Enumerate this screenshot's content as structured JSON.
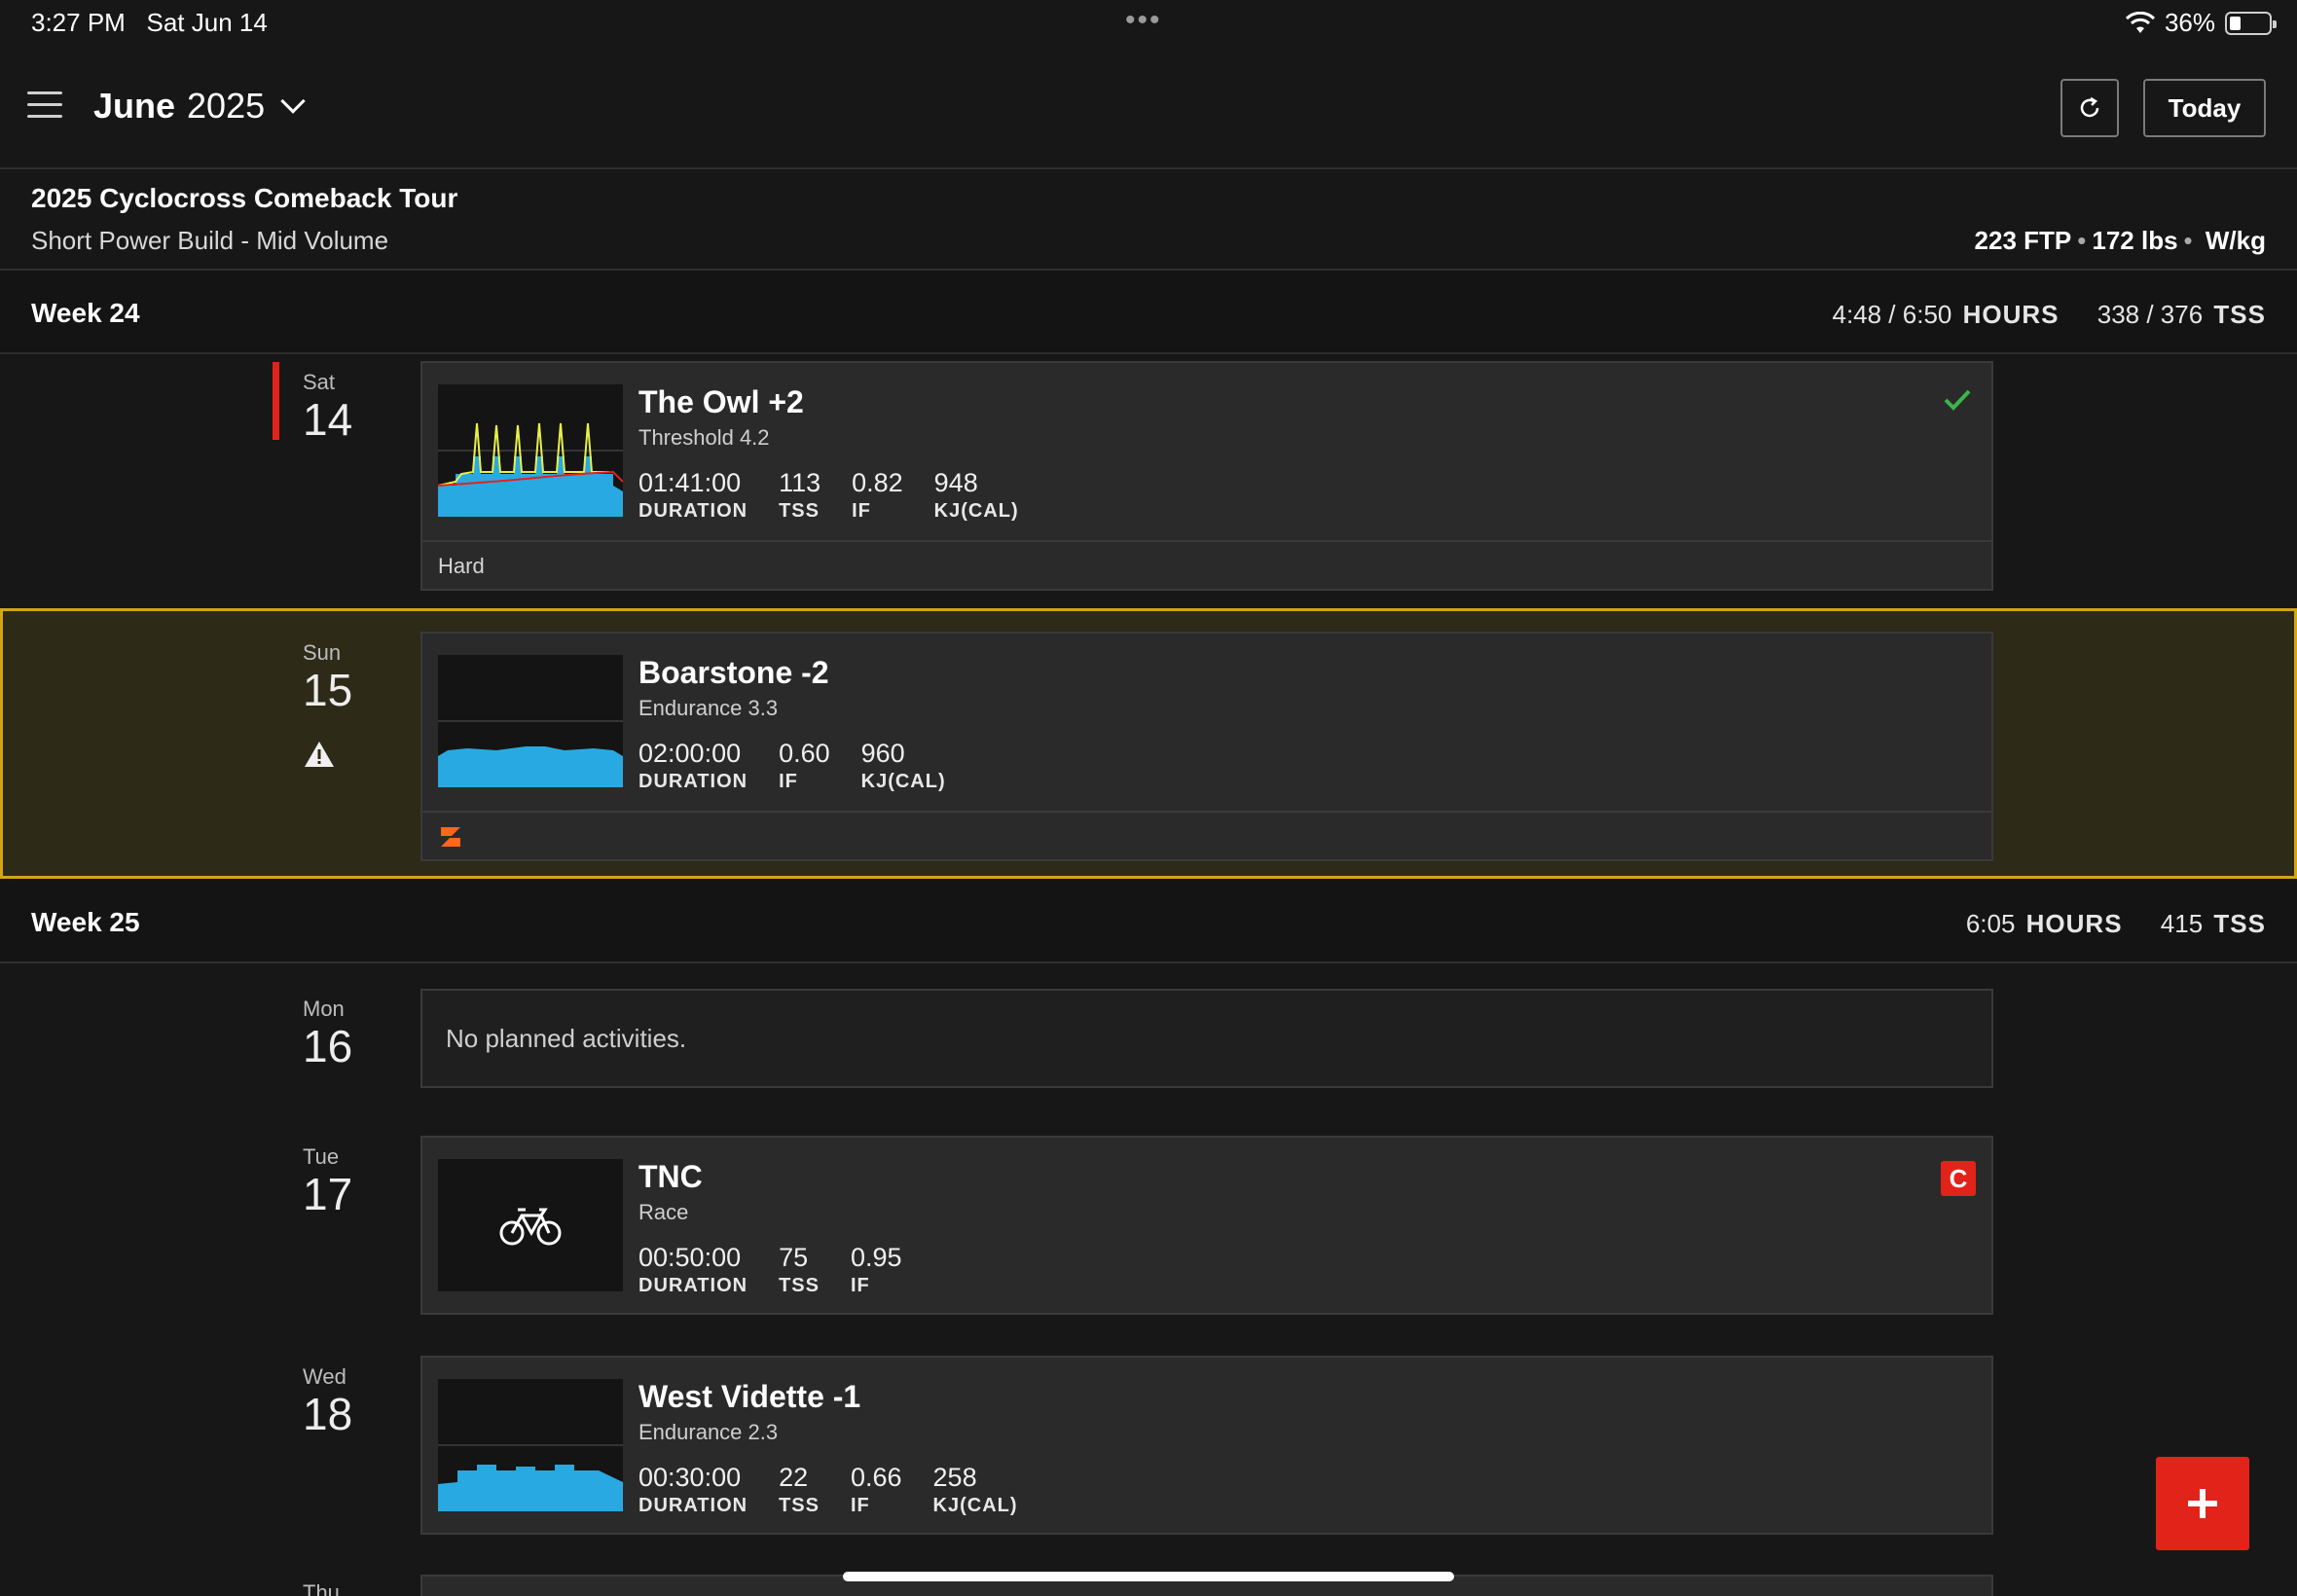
{
  "status": {
    "time": "3:27 PM",
    "date": "Sat Jun 14",
    "battery": "36%"
  },
  "header": {
    "month_bold": "June",
    "year": "2025",
    "today_label": "Today"
  },
  "plan": {
    "title": "2025 Cyclocross Comeback Tour",
    "subtitle": "Short Power Build - Mid Volume",
    "ftp": "223 FTP",
    "weight": "172 lbs",
    "unit": "W/kg"
  },
  "week24": {
    "title": "Week 24",
    "hours_val": "4:48 / 6:50",
    "hours_lbl": "HOURS",
    "tss_val": "338 / 376",
    "tss_lbl": "TSS"
  },
  "week25": {
    "title": "Week 25",
    "hours_val": "6:05",
    "hours_lbl": "HOURS",
    "tss_val": "415",
    "tss_lbl": "TSS"
  },
  "days": {
    "sat": {
      "name": "Sat",
      "num": "14"
    },
    "sun": {
      "name": "Sun",
      "num": "15"
    },
    "mon": {
      "name": "Mon",
      "num": "16"
    },
    "tue": {
      "name": "Tue",
      "num": "17"
    },
    "wed": {
      "name": "Wed",
      "num": "18"
    },
    "thu": {
      "name": "Thu"
    }
  },
  "workouts": {
    "owl": {
      "title": "The Owl +2",
      "subtitle": "Threshold 4.2",
      "duration": "01:41:00",
      "tss": "113",
      "if": "0.82",
      "kj": "948",
      "footer": "Hard"
    },
    "boarstone": {
      "title": "Boarstone -2",
      "subtitle": "Endurance 3.3",
      "duration": "02:00:00",
      "if": "0.60",
      "kj": "960"
    },
    "tnc": {
      "title": "TNC",
      "subtitle": "Race",
      "duration": "00:50:00",
      "tss": "75",
      "if": "0.95",
      "badge": "C"
    },
    "vidette": {
      "title": "West Vidette -1",
      "subtitle": "Endurance 2.3",
      "duration": "00:30:00",
      "tss": "22",
      "if": "0.66",
      "kj": "258"
    }
  },
  "labels": {
    "duration": "DURATION",
    "tss": "TSS",
    "if": "IF",
    "kj": "KJ(CAL)"
  },
  "empty_text": "No planned activities.",
  "colors": {
    "accent_red": "#e2231a",
    "power_blue": "#29a9e1",
    "highlight_gold": "#d4a514",
    "check_green": "#3db44a",
    "zwift_orange": "#fc6719"
  },
  "icons": {
    "menu": "menu-icon",
    "refresh": "refresh-icon",
    "check": "check-icon",
    "warning": "warning-icon",
    "bike": "bike-icon",
    "zwift": "zwift-icon",
    "add": "plus-icon"
  }
}
